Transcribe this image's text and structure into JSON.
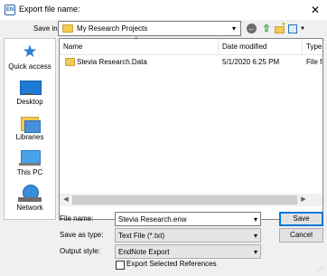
{
  "window": {
    "title": "Export file name:",
    "app_icon_text": "EN",
    "close_glyph": "✕"
  },
  "save_in": {
    "label": "Save in:",
    "value": "My Research Projects"
  },
  "places": [
    {
      "label": "Quick access",
      "icon": "star-icon"
    },
    {
      "label": "Desktop",
      "icon": "desktop-icon"
    },
    {
      "label": "Libraries",
      "icon": "libraries-icon"
    },
    {
      "label": "This PC",
      "icon": "computer-icon"
    },
    {
      "label": "Network",
      "icon": "network-icon"
    }
  ],
  "file_list": {
    "columns": [
      "Name",
      "Date modified",
      "Type"
    ],
    "rows": [
      {
        "name": "Stevia Research.Data",
        "date": "5/1/2020 6:25 PM",
        "type": "File fo",
        "icon": "folder-icon"
      }
    ]
  },
  "form": {
    "file_name_label": "File name:",
    "file_name_value": "Stevia Research.enw",
    "save_as_type_label": "Save as type:",
    "save_as_type_value": "Text File (*.txt)",
    "output_style_label": "Output style:",
    "output_style_value": "EndNote Export",
    "export_selected_label": "Export Selected References",
    "export_selected_checked": false
  },
  "buttons": {
    "save": "Save",
    "cancel": "Cancel"
  },
  "colors": {
    "accent": "#0078d7",
    "folder": "#f3c957"
  }
}
